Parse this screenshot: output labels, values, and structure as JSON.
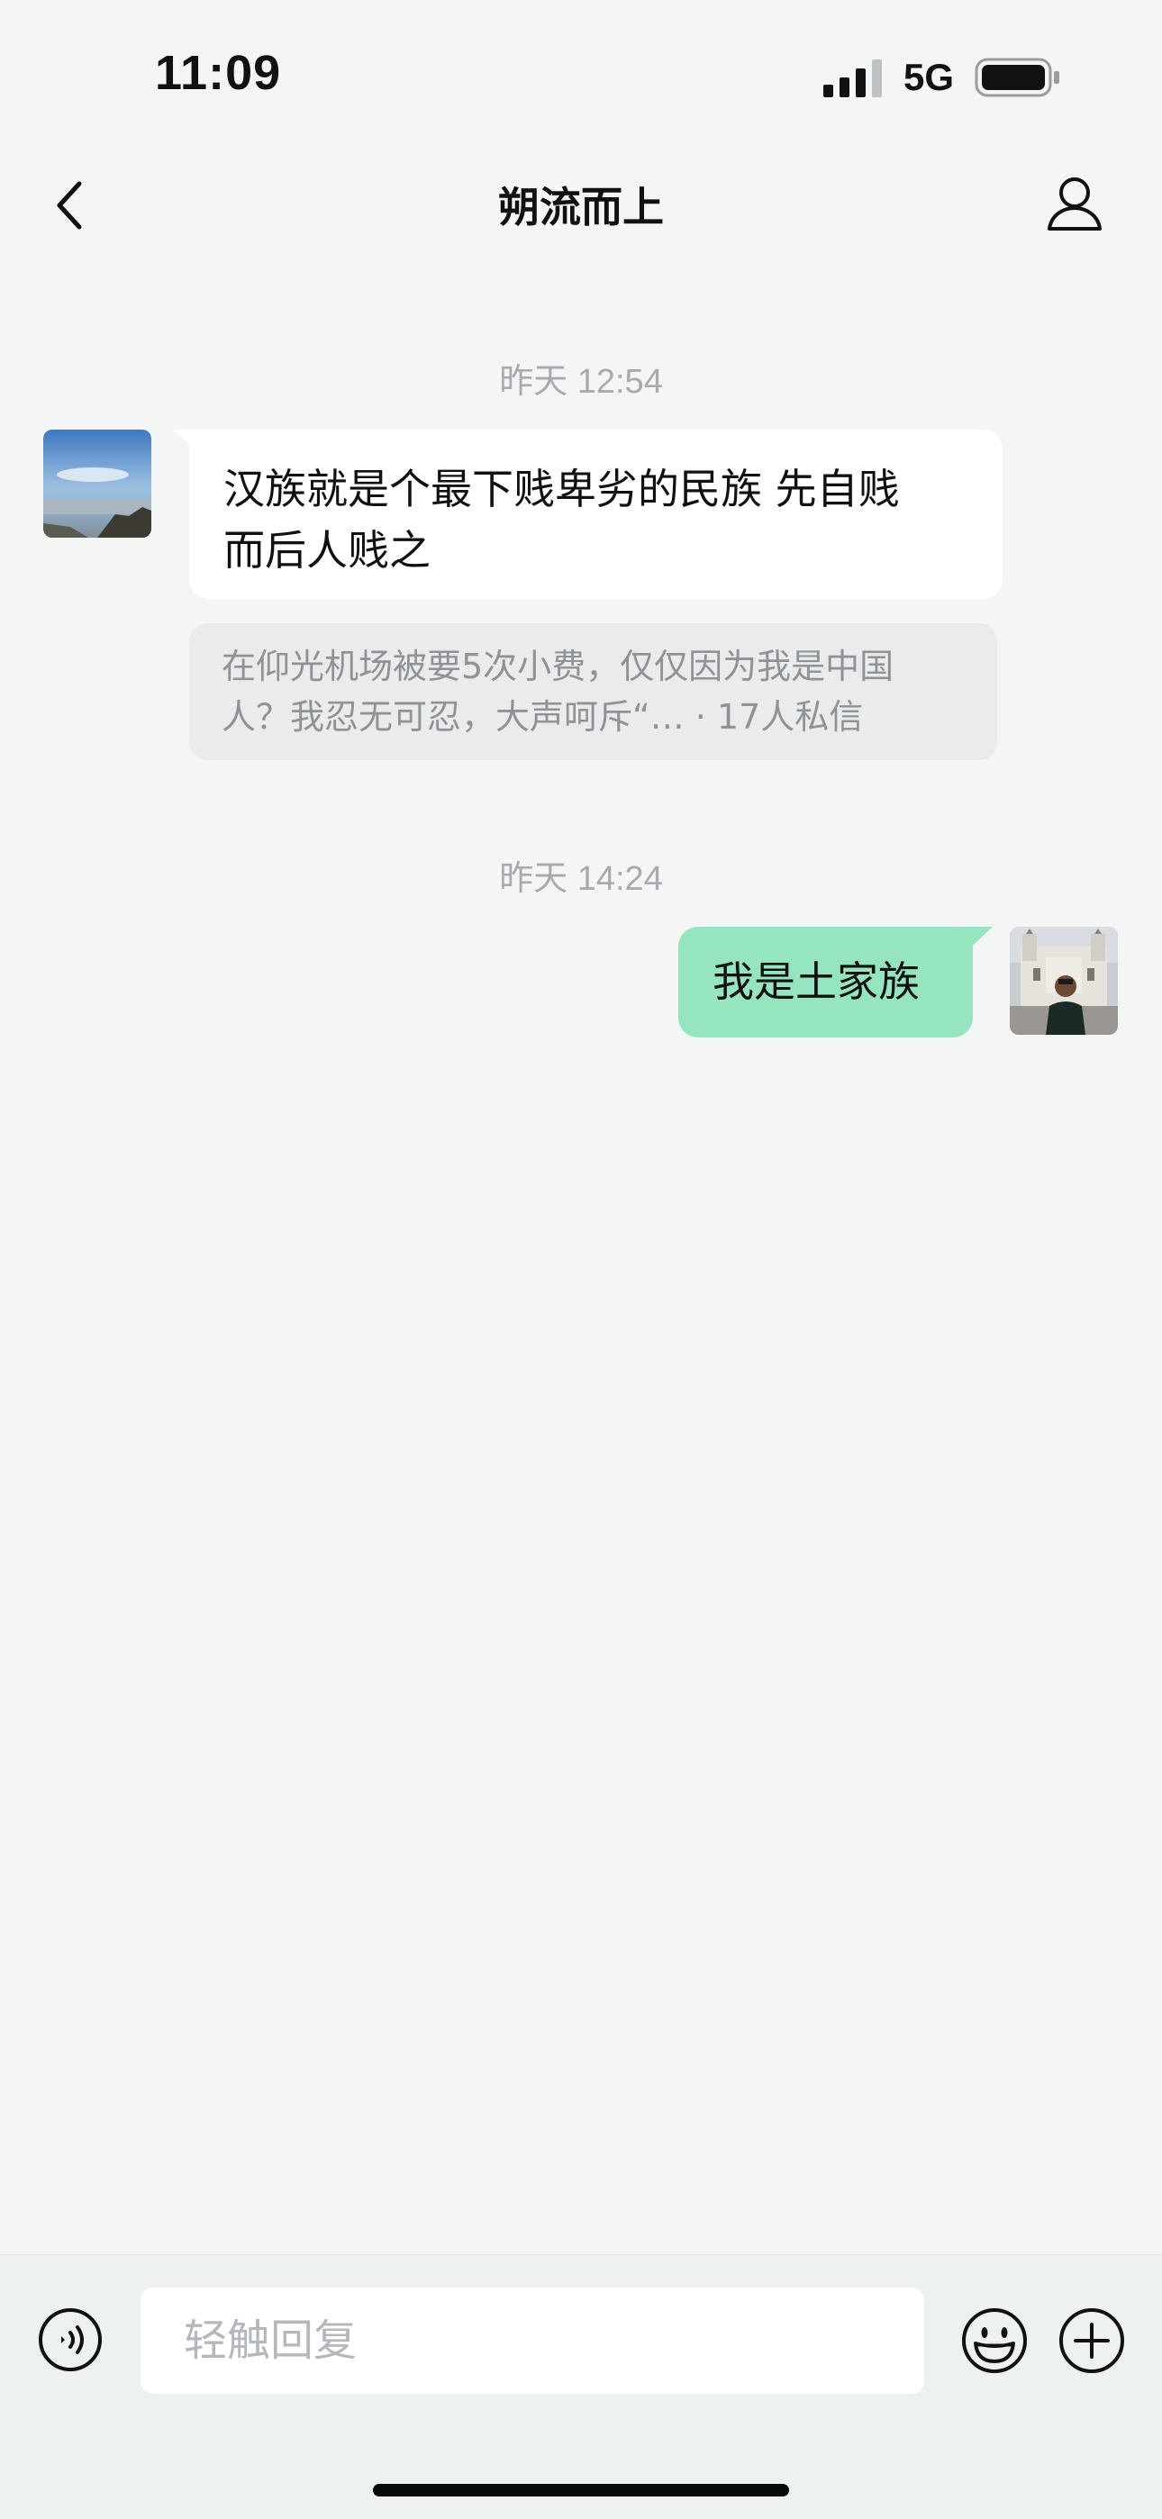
{
  "status_bar": {
    "time": "11:09",
    "network": "5G",
    "icons": [
      "signal-icon",
      "battery-icon"
    ]
  },
  "nav": {
    "title": "朔流而上",
    "icons": [
      "chevron-left-icon",
      "person-icon"
    ]
  },
  "messages": [
    {
      "timestamp": "昨天 12:54",
      "direction": "incoming",
      "text_line1": "汉族就是个最下贱卑劣的民族 先自贱",
      "text_line2": "而后人贱之",
      "link_card": {
        "line1": "在仰光机场被要5次小费，仅仅因为我是中国",
        "line2": "人？我忍无可忍，大声呵斥“…  ·  17人私信"
      }
    },
    {
      "timestamp": "昨天 14:24",
      "direction": "outgoing",
      "text": "我是土家族"
    }
  ],
  "composer": {
    "placeholder": "轻触回复",
    "icons": [
      "voice-icon",
      "emoji-icon",
      "plus-icon"
    ]
  },
  "colors": {
    "background": "#f4f5f5",
    "incoming_bubble": "#ffffff",
    "outgoing_bubble": "#95e6c0",
    "timestamp_text": "#a7abaf",
    "link_card_bg": "#eaebeb"
  }
}
